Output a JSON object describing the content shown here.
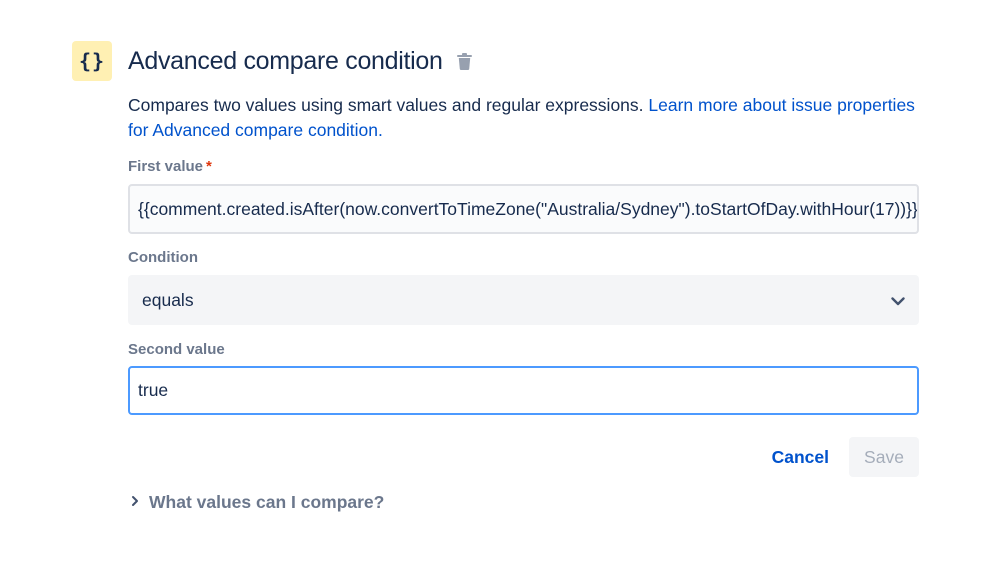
{
  "header": {
    "icon_glyph": "{}",
    "title": "Advanced compare condition"
  },
  "description": {
    "text": "Compares two values using smart values and regular expressions. ",
    "link": "Learn more about issue properties for Advanced compare condition."
  },
  "first_value": {
    "label": "First value",
    "required_mark": "*",
    "value": "{{comment.created.isAfter(now.convertToTimeZone(\"Australia/Sydney\").toStartOfDay.withHour(17))}}"
  },
  "condition": {
    "label": "Condition",
    "selected": "equals"
  },
  "second_value": {
    "label": "Second value",
    "value": "true"
  },
  "actions": {
    "cancel_label": "Cancel",
    "save_label": "Save"
  },
  "help": {
    "label": "What values can I compare?"
  },
  "colors": {
    "icon_bg": "#fff0b3",
    "link": "#0052cc",
    "required": "#de350b",
    "focus_border": "#4c9aff",
    "label": "#6b778c"
  },
  "icons": [
    "braces-icon",
    "trash-icon",
    "chevron-down-icon",
    "chevron-right-icon"
  ]
}
